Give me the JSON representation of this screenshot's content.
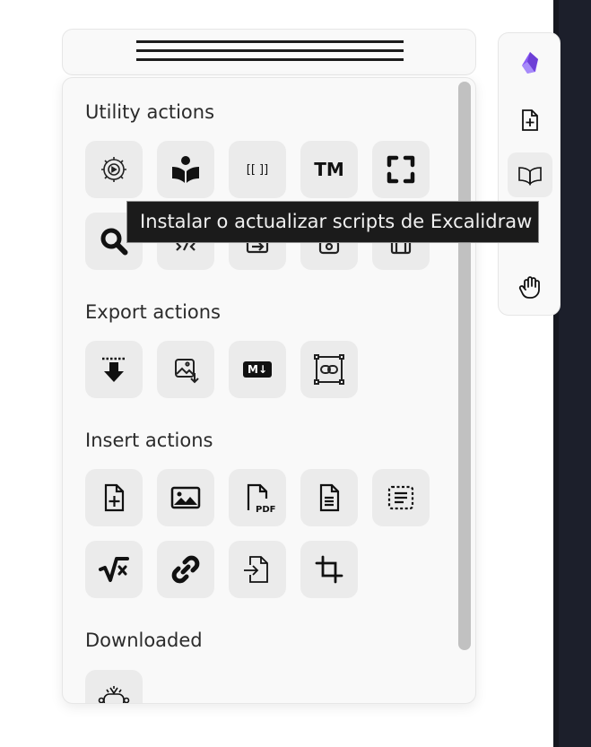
{
  "sections": {
    "utility": "Utility actions",
    "export": "Export actions",
    "insert": "Insert actions",
    "downloaded": "Downloaded"
  },
  "tooltip": "Instalar o actualizar scripts de Excalidraw",
  "icons": {
    "brackets_text": "[[ ]]",
    "trademark_text": "TM",
    "pdf_text": "PDF",
    "markdown_text": "M↓"
  },
  "utility_buttons": [
    "settings-video-icon",
    "read-book-icon",
    "wikilink-brackets-icon",
    "trademark-icon",
    "fullscreen-icon",
    "search-icon",
    "script-icon",
    "export-arrow-icon",
    "library-icon",
    "frame-icon"
  ],
  "export_buttons": [
    "save-to-bottom-icon",
    "export-image-icon",
    "markdown-icon",
    "embed-link-icon"
  ],
  "insert_buttons": [
    "new-file-icon",
    "insert-image-icon",
    "insert-pdf-icon",
    "insert-document-icon",
    "insert-text-block-icon",
    "latex-formula-icon",
    "insert-link-icon",
    "import-file-icon",
    "crop-icon"
  ],
  "downloaded_buttons": [
    "script-bot-icon"
  ],
  "side_toolbar": [
    "obsidian-logo-icon",
    "new-drawing-icon",
    "book-icon",
    "hand-tool-icon"
  ],
  "colors": {
    "panel_bg": "#f9f9f9",
    "button_bg": "#ebebeb",
    "tooltip_bg": "#1b1b1b",
    "accent_purple": "#7c4dff",
    "dark_strip": "#1c1f2b"
  }
}
